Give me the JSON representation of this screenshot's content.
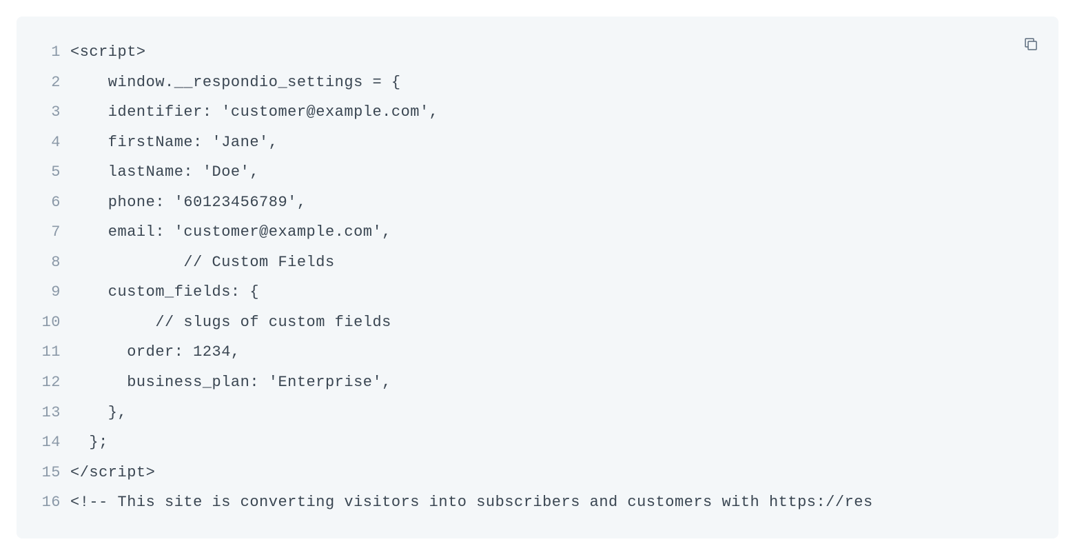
{
  "code": {
    "lines": [
      {
        "num": "1",
        "text": "<script>"
      },
      {
        "num": "2",
        "text": "    window.__respondio_settings = {"
      },
      {
        "num": "3",
        "text": "    identifier: 'customer@example.com',"
      },
      {
        "num": "4",
        "text": "    firstName: 'Jane',"
      },
      {
        "num": "5",
        "text": "    lastName: 'Doe',"
      },
      {
        "num": "6",
        "text": "    phone: '60123456789',"
      },
      {
        "num": "7",
        "text": "    email: 'customer@example.com',"
      },
      {
        "num": "8",
        "text": "            // Custom Fields"
      },
      {
        "num": "9",
        "text": "    custom_fields: {"
      },
      {
        "num": "10",
        "text": "         // slugs of custom fields"
      },
      {
        "num": "11",
        "text": "      order: 1234,"
      },
      {
        "num": "12",
        "text": "      business_plan: 'Enterprise',"
      },
      {
        "num": "13",
        "text": "    },"
      },
      {
        "num": "14",
        "text": "  };"
      },
      {
        "num": "15",
        "text": "</script>"
      },
      {
        "num": "16",
        "text": "<!-- This site is converting visitors into subscribers and customers with https://res"
      }
    ]
  }
}
